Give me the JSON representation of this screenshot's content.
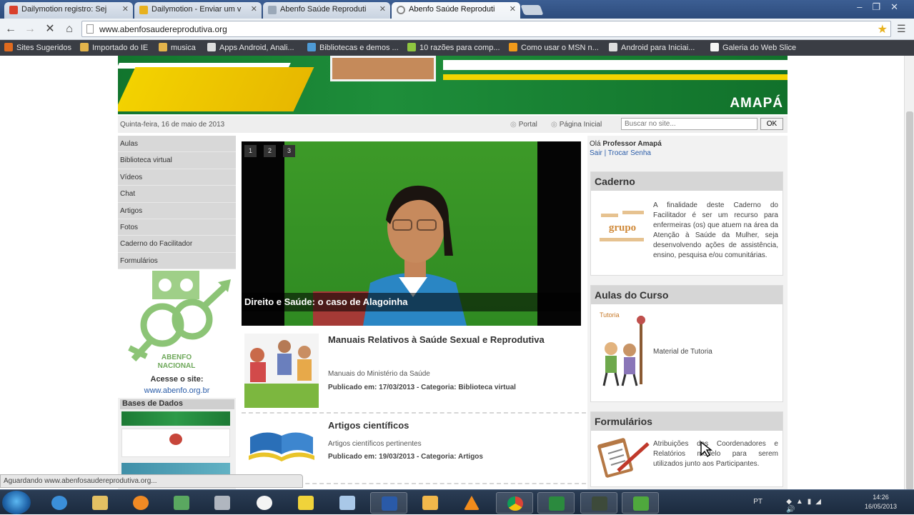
{
  "browser": {
    "tabs": [
      {
        "label": "Dailymotion registro: Sej",
        "active": false
      },
      {
        "label": "Dailymotion - Enviar um v",
        "active": false
      },
      {
        "label": "Abenfo Saúde Reproduti",
        "active": false
      },
      {
        "label": "Abenfo Saúde Reproduti",
        "active": true
      }
    ],
    "url": "www.abenfosaudereprodutiva.org",
    "bookmarks": [
      "Sites Sugeridos",
      "Importado do IE",
      "musica",
      "Apps Android, Anali...",
      "Bibliotecas e demos ...",
      "10 razões para comp...",
      "Como usar o MSN n...",
      "Android para Iniciai...",
      "Galeria do Web Slice"
    ]
  },
  "header": {
    "state": "AMAPÁ",
    "date": "Quinta-feira, 16 de maio de 2013",
    "links": [
      "Portal",
      "Página Inicial"
    ],
    "search_placeholder": "Buscar no site...",
    "search_button": "OK"
  },
  "sidebar": {
    "menu": [
      "Aulas",
      "Biblioteca virtual",
      "Vídeos",
      "Chat",
      "Artigos",
      "Fotos",
      "Caderno do Facilitador",
      "Formulários"
    ],
    "logo_text": [
      "ABENFO",
      "NACIONAL"
    ],
    "acesse_label": "Acesse o site:",
    "acesse_url": "www.abenfo.org.br",
    "bases_title": "Bases de Dados"
  },
  "slider": {
    "numbers": [
      "1",
      "2",
      "3"
    ],
    "caption": "Direito e Saúde: o caso de Alagoinha"
  },
  "articles": [
    {
      "title": "Manuais Relativos à Saúde Sexual e Reprodutiva",
      "desc": "Manuais do Ministério da Saúde",
      "meta_published_label": "Publicado em:",
      "meta_date": "17/03/2013",
      "meta_category_label": "Categoria:",
      "meta_category": "Biblioteca virtual"
    },
    {
      "title": "Artigos científicos",
      "desc": "Artigos científicos pertinentes",
      "meta_published_label": "Publicado em:",
      "meta_date": "19/03/2013",
      "meta_category_label": "Categoria:",
      "meta_category": "Artigos"
    }
  ],
  "user": {
    "greeting": "Olá",
    "name": "Professor Amapá",
    "logout": "Sair",
    "change_password": "Trocar Senha"
  },
  "right_boxes": [
    {
      "title": "Caderno",
      "text": "A finalidade deste Caderno do Facilitador é ser um recurso para enfermeiras (os) que atuem na área da Atenção à Saúde da Mulher, seja desenvolvendo ações de assistência, ensino, pesquisa e/ou comunitárias.",
      "image_text": "grupo"
    },
    {
      "title": "Aulas do Curso",
      "text": "Material de Tutoria",
      "image_text": "Tutoria"
    },
    {
      "title": "Formulários",
      "text": "Atribuições dos Coordenadores e Relatórios modelo para serem utilizados junto aos Participantes."
    }
  ],
  "status": "Aguardando www.abenfosaudereprodutiva.org...",
  "taskbar": {
    "language": "PT",
    "time": "14:26",
    "date": "16/05/2013"
  },
  "colors": {
    "banner_green": "#1e8e3a",
    "banner_yellow": "#f2d400",
    "link_blue": "#2a5ca8",
    "menu_gray": "#d8d8d8"
  }
}
